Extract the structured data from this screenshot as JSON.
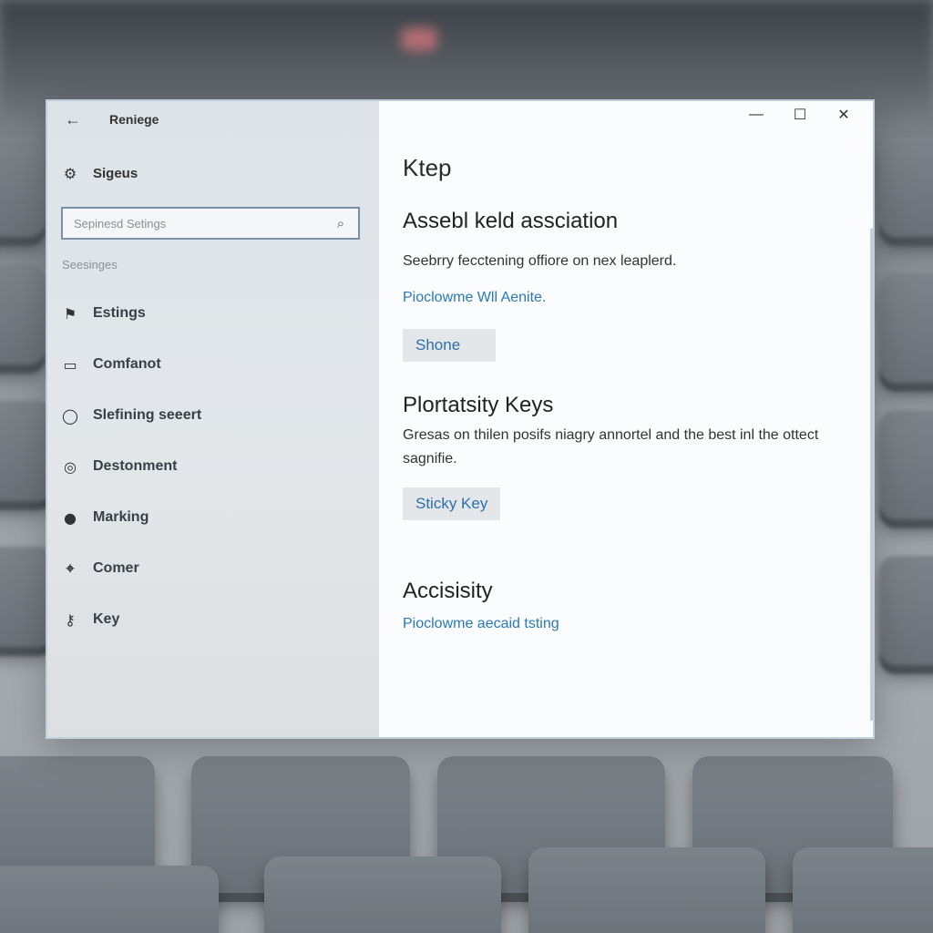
{
  "window": {
    "title": "Reniege",
    "back_glyph": "←",
    "controls": {
      "minimize": "—",
      "maximize": "☐",
      "close": "✕"
    }
  },
  "sidebar": {
    "home_label": "Sigeus",
    "search": {
      "value": "",
      "placeholder": "Sepinesd Setings",
      "icon": "search-icon"
    },
    "section_label": "Seesinges",
    "items": [
      {
        "label": "Estings",
        "icon": "flag-icon"
      },
      {
        "label": "Comfanot",
        "icon": "display-icon"
      },
      {
        "label": "Slefining seeert",
        "icon": "circle-icon"
      },
      {
        "label": "Destonment",
        "icon": "disc-icon"
      },
      {
        "label": "Marking",
        "icon": "palette-icon"
      },
      {
        "label": "Comer",
        "icon": "location-icon"
      },
      {
        "label": "Key",
        "icon": "key-icon"
      }
    ]
  },
  "content": {
    "title": "Ktep",
    "sections": [
      {
        "heading": "Assebl keld assciation",
        "description": "Seebrry fecctening offiore on nex leaplerd.",
        "link": "Pioclowme Wll Aenite.",
        "button": "Shone"
      },
      {
        "heading": "Plortatsity Keys",
        "description": "Gresas on thilen posifs niagry annortel and the best inl the ottect sagnifie.",
        "button": "Sticky Key"
      },
      {
        "heading": "Accisisity",
        "link": "Pioclowme aecaid tsting"
      }
    ]
  },
  "colors": {
    "accent": "#2a78b8",
    "sidebar_bg": "#dde3e8",
    "search_border": "#7a8fa8"
  }
}
